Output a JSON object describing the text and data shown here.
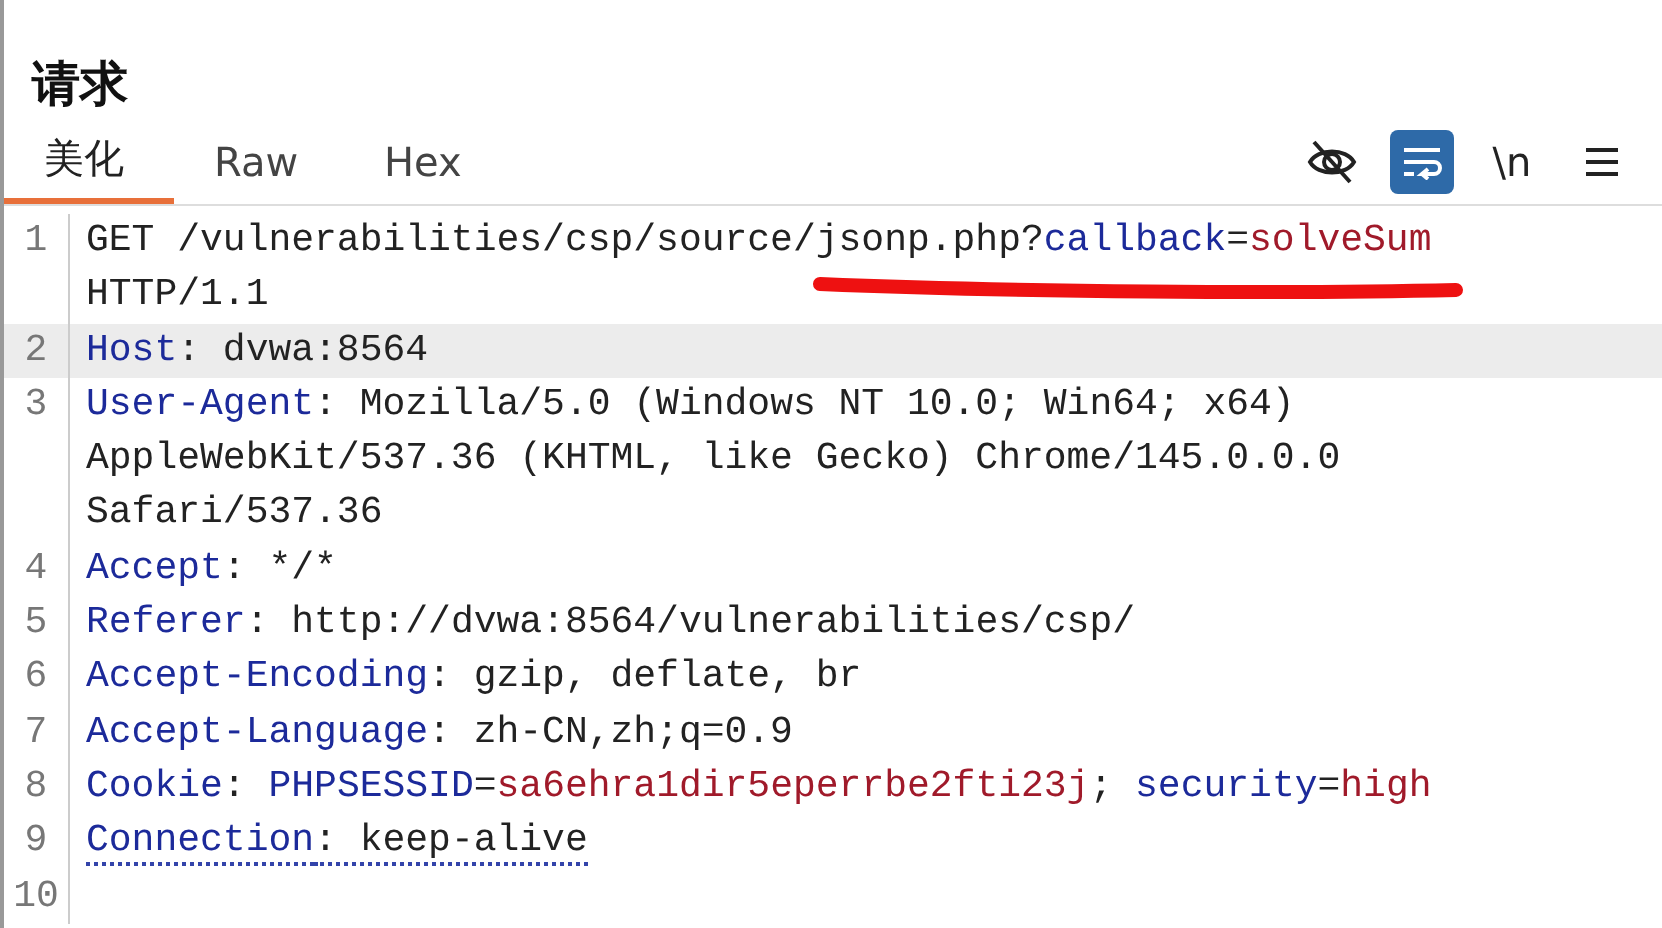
{
  "title": "请求",
  "tabs": [
    {
      "label": "美化",
      "selected": true
    },
    {
      "label": "Raw",
      "selected": false
    },
    {
      "label": "Hex",
      "selected": false
    }
  ],
  "toolbar": [
    {
      "kind": "visibility",
      "on": false
    },
    {
      "kind": "wrap",
      "on": true
    },
    {
      "kind": "newline",
      "label": "\\n",
      "on": false
    },
    {
      "kind": "menu",
      "on": false
    }
  ],
  "lines": [
    {
      "number": "1",
      "current": false,
      "underlined": false,
      "rows": [
        [
          {
            "kind": "plain",
            "text": "GET /vulnerabilities/csp/source/jsonp.php?"
          },
          {
            "kind": "name",
            "text": "callback"
          },
          {
            "kind": "plain",
            "text": "="
          },
          {
            "kind": "value",
            "text": "solveSum"
          }
        ],
        [
          {
            "kind": "plain",
            "text": "HTTP/1.1"
          }
        ]
      ]
    },
    {
      "number": "2",
      "current": true,
      "underlined": false,
      "rows": [
        [
          {
            "kind": "name",
            "text": "Host"
          },
          {
            "kind": "plain",
            "text": ": dvwa:8564"
          }
        ]
      ]
    },
    {
      "number": "3",
      "current": false,
      "underlined": false,
      "rows": [
        [
          {
            "kind": "name",
            "text": "User-Agent"
          },
          {
            "kind": "plain",
            "text": ": Mozilla/5.0 (Windows NT 10.0; Win64; x64)"
          }
        ],
        [
          {
            "kind": "plain",
            "text": "AppleWebKit/537.36 (KHTML, like Gecko) Chrome/145.0.0.0"
          }
        ],
        [
          {
            "kind": "plain",
            "text": "Safari/537.36"
          }
        ]
      ]
    },
    {
      "number": "4",
      "current": false,
      "underlined": false,
      "rows": [
        [
          {
            "kind": "name",
            "text": "Accept"
          },
          {
            "kind": "plain",
            "text": ": */*"
          }
        ]
      ]
    },
    {
      "number": "5",
      "current": false,
      "underlined": false,
      "rows": [
        [
          {
            "kind": "name",
            "text": "Referer"
          },
          {
            "kind": "plain",
            "text": ": http://dvwa:8564/vulnerabilities/csp/"
          }
        ]
      ]
    },
    {
      "number": "6",
      "current": false,
      "underlined": false,
      "rows": [
        [
          {
            "kind": "name",
            "text": "Accept-Encoding"
          },
          {
            "kind": "plain",
            "text": ": gzip, deflate, br"
          }
        ]
      ]
    },
    {
      "number": "7",
      "current": false,
      "underlined": false,
      "rows": [
        [
          {
            "kind": "name",
            "text": "Accept-Language"
          },
          {
            "kind": "plain",
            "text": ": zh-CN,zh;q=0.9"
          }
        ]
      ]
    },
    {
      "number": "8",
      "current": false,
      "underlined": false,
      "rows": [
        [
          {
            "kind": "name",
            "text": "Cookie"
          },
          {
            "kind": "plain",
            "text": ": "
          },
          {
            "kind": "name",
            "text": "PHPSESSID"
          },
          {
            "kind": "plain",
            "text": "="
          },
          {
            "kind": "value",
            "text": "sa6ehra1dir5eperrbe2fti23j"
          },
          {
            "kind": "plain",
            "text": "; "
          },
          {
            "kind": "name",
            "text": "security"
          },
          {
            "kind": "plain",
            "text": "="
          },
          {
            "kind": "value",
            "text": "high"
          }
        ]
      ]
    },
    {
      "number": "9",
      "current": false,
      "underlined": true,
      "rows": [
        [
          {
            "kind": "name",
            "text": "Connection"
          },
          {
            "kind": "plain",
            "text": ": keep-alive"
          }
        ]
      ]
    },
    {
      "number": "10",
      "current": false,
      "underlined": false
    }
  ]
}
